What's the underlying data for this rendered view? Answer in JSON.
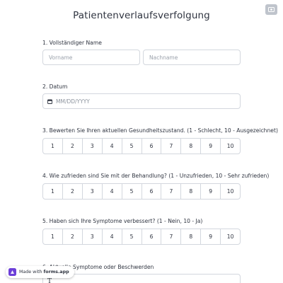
{
  "form": {
    "title": "Patientenverlaufsverfolgung"
  },
  "questions": {
    "name": {
      "label": "1. Vollständiger Name",
      "first_placeholder": "Vorname",
      "last_placeholder": "Nachname"
    },
    "date": {
      "label": "2. Datum",
      "placeholder": "MM/DD/YYYY",
      "icon": "calendar-icon"
    },
    "health": {
      "label": "3. Bewerten Sie Ihren aktuellen Gesundheitszustand. (1 - Schlecht, 10 - Ausgezeichnet)",
      "options": [
        "1",
        "2",
        "3",
        "4",
        "5",
        "6",
        "7",
        "8",
        "9",
        "10"
      ]
    },
    "satisfaction": {
      "label": "4. Wie zufrieden sind Sie mit der Behandlung? (1 - Unzufrieden, 10 - Sehr zufrieden)",
      "options": [
        "1",
        "2",
        "3",
        "4",
        "5",
        "6",
        "7",
        "8",
        "9",
        "10"
      ]
    },
    "improvement": {
      "label": "5. Haben sich Ihre Symptome verbessert? (1 - Nein, 10 - Ja)",
      "options": [
        "1",
        "2",
        "3",
        "4",
        "5",
        "6",
        "7",
        "8",
        "9",
        "10"
      ]
    },
    "symptoms": {
      "label": "6. Aktuelle Symptome oder Beschwerden",
      "icon": "text-format-icon"
    }
  },
  "badge": {
    "prefix": "Made with",
    "brand": "forms.app"
  },
  "colors": {
    "border": "#d3d7de",
    "text": "#2f3440",
    "placeholder": "#9aa1ab",
    "corner_button": "#bfc4cc",
    "logo_purple": "#6c3fd8"
  }
}
